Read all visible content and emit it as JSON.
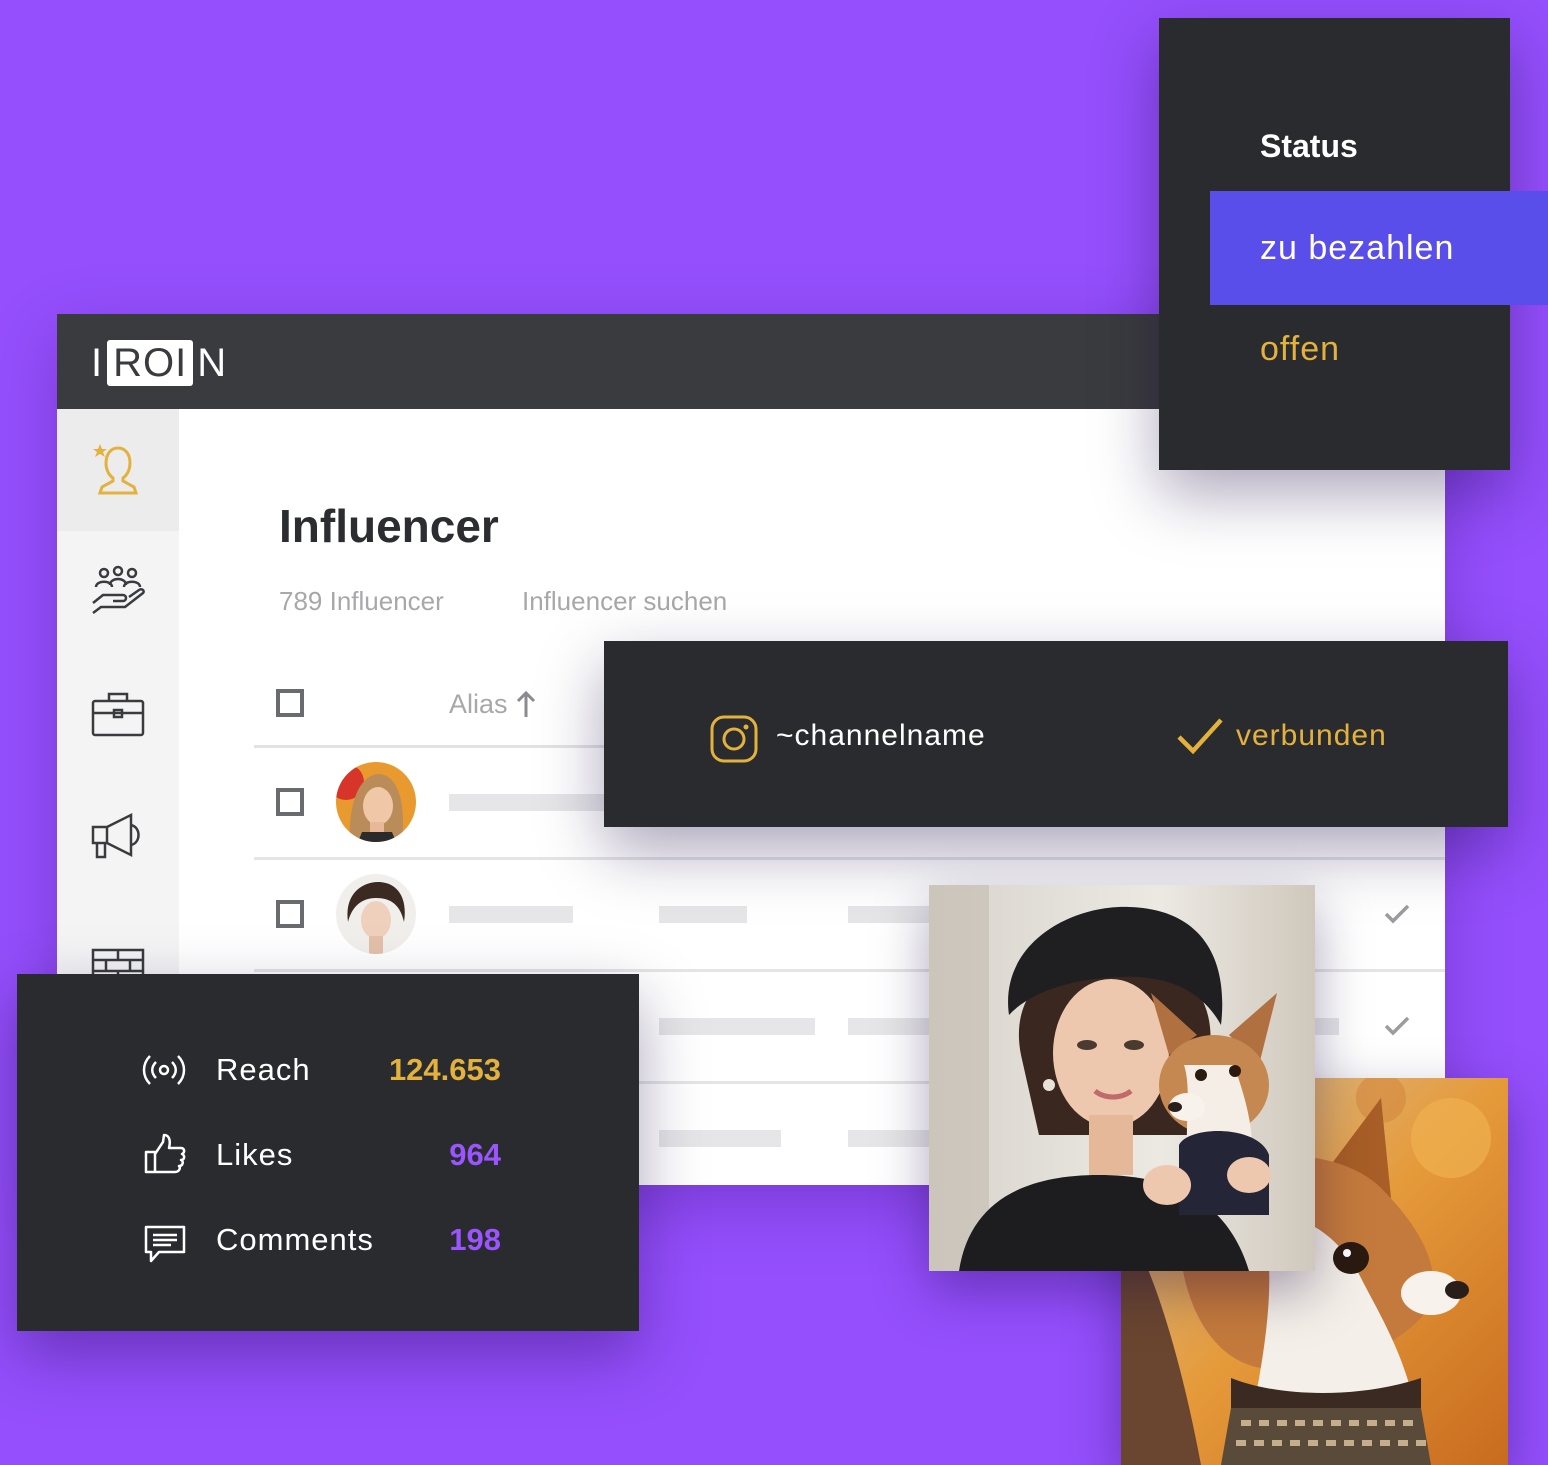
{
  "app": {
    "logo": {
      "part1": "I",
      "part2": "ROI",
      "part3": "N"
    },
    "page_title": "Influencer",
    "influencer_count": "789 Influencer",
    "search_placeholder": "Influencer suchen",
    "table": {
      "alias_header": "Alias",
      "sort_icon": "arrow-up-icon"
    },
    "sidebar_icons": [
      "influencer-star-icon",
      "team-hand-icon",
      "briefcase-icon",
      "megaphone-icon",
      "wall-icon"
    ]
  },
  "status_menu": {
    "title": "Status",
    "options": [
      {
        "label": "zu bezahlen",
        "selected": true
      },
      {
        "label": "offen",
        "selected": false
      }
    ]
  },
  "channel": {
    "icon": "instagram-icon",
    "name": "~channelname",
    "status": "verbunden"
  },
  "stats": [
    {
      "icon": "broadcast-icon",
      "label": "Reach",
      "value": "124.653",
      "color": "#e3b23c"
    },
    {
      "icon": "thumbs-up-icon",
      "label": "Likes",
      "value": "964",
      "color": "#9a55ff"
    },
    {
      "icon": "comment-icon",
      "label": "Comments",
      "value": "198",
      "color": "#9a55ff"
    }
  ],
  "colors": {
    "background": "#954ffd",
    "accent_yellow": "#e3b23c",
    "accent_purple": "#9a55ff",
    "selected_blue": "#5a4eea",
    "dark_card": "#2a2b2e",
    "topbar": "#3a3b3e"
  }
}
